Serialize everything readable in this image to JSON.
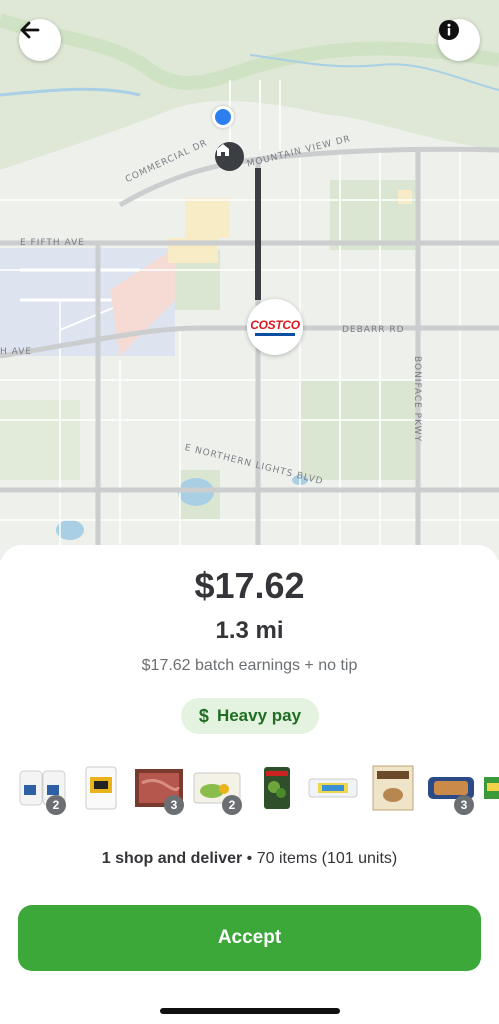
{
  "map": {
    "streets": {
      "commercial": "COMMERCIAL DR",
      "mountain_view": "MOUNTAIN VIEW DR",
      "fifth_ave": "E FIFTH AVE",
      "ave_partial": "H AVE",
      "debarr": "DEBARR RD",
      "boniface": "BONIFACE PKWY",
      "northern_lights": "E NORTHERN LIGHTS BLVD"
    },
    "store_logo": "COSTCO",
    "icons": {
      "back": "arrow-left-icon",
      "info": "info-icon",
      "home": "home-icon",
      "location": "current-location-dot"
    },
    "colors": {
      "route": "#3b3f43",
      "location": "#2d7ff0",
      "store_red": "#d71a21",
      "store_blue": "#0b4ea2"
    }
  },
  "offer": {
    "price": "$17.62",
    "distance": "1.3 mi",
    "earnings_note": "$17.62 batch earnings + no tip",
    "pay_badge": "Heavy pay",
    "pay_icon": "$",
    "items": [
      {
        "name": "milk-jugs",
        "qty": "2"
      },
      {
        "name": "flour-bag",
        "qty": ""
      },
      {
        "name": "ground-beef",
        "qty": "3"
      },
      {
        "name": "salad-kit",
        "qty": "2"
      },
      {
        "name": "spinach-bag",
        "qty": ""
      },
      {
        "name": "eggs-carton",
        "qty": ""
      },
      {
        "name": "almond-snack",
        "qty": ""
      },
      {
        "name": "bread-loaf",
        "qty": "3"
      },
      {
        "name": "green-product",
        "qty": ""
      }
    ],
    "summary_bold": "1 shop and deliver",
    "summary_rest": " • 70 items (101 units)",
    "accept_label": "Accept",
    "colors": {
      "accept": "#3ca83a",
      "badge_bg": "#e4f3df",
      "badge_text": "#1f6d22"
    }
  }
}
